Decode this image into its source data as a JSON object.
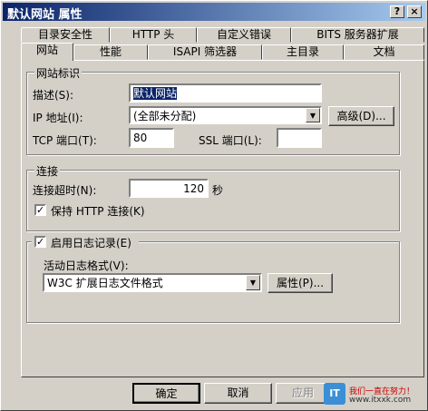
{
  "window": {
    "title": "默认网站 属性"
  },
  "title_buttons": {
    "help": "?",
    "close": "×"
  },
  "tabs_back": [
    "目录安全性",
    "HTTP 头",
    "自定义错误",
    "BITS 服务器扩展"
  ],
  "tabs_front": [
    "网站",
    "性能",
    "ISAPI 筛选器",
    "主目录",
    "文档"
  ],
  "site_identity": {
    "group_label": "网站标识",
    "description_label": "描述(S):",
    "description_value": "默认网站",
    "ip_label": "IP 地址(I):",
    "ip_value": "(全部未分配)",
    "advanced_button": "高级(D)...",
    "tcp_label": "TCP 端口(T):",
    "tcp_value": "80",
    "ssl_label": "SSL 端口(L):",
    "ssl_value": ""
  },
  "connection": {
    "group_label": "连接",
    "timeout_label": "连接超时(N):",
    "timeout_value": "120",
    "timeout_unit": "秒",
    "keepalive_label": "保持 HTTP 连接(K)",
    "keepalive_checked": true
  },
  "logging": {
    "enable_label": "启用日志记录(E)",
    "enable_checked": true,
    "format_label": "活动日志格式(V):",
    "format_value": "W3C 扩展日志文件格式",
    "properties_button": "属性(P)..."
  },
  "footer": {
    "ok": "确定",
    "cancel": "取消",
    "apply": "应用"
  },
  "watermark": {
    "logo": "IT",
    "slogan": "我们一直在努力！",
    "url": "www.itxxk.com"
  }
}
